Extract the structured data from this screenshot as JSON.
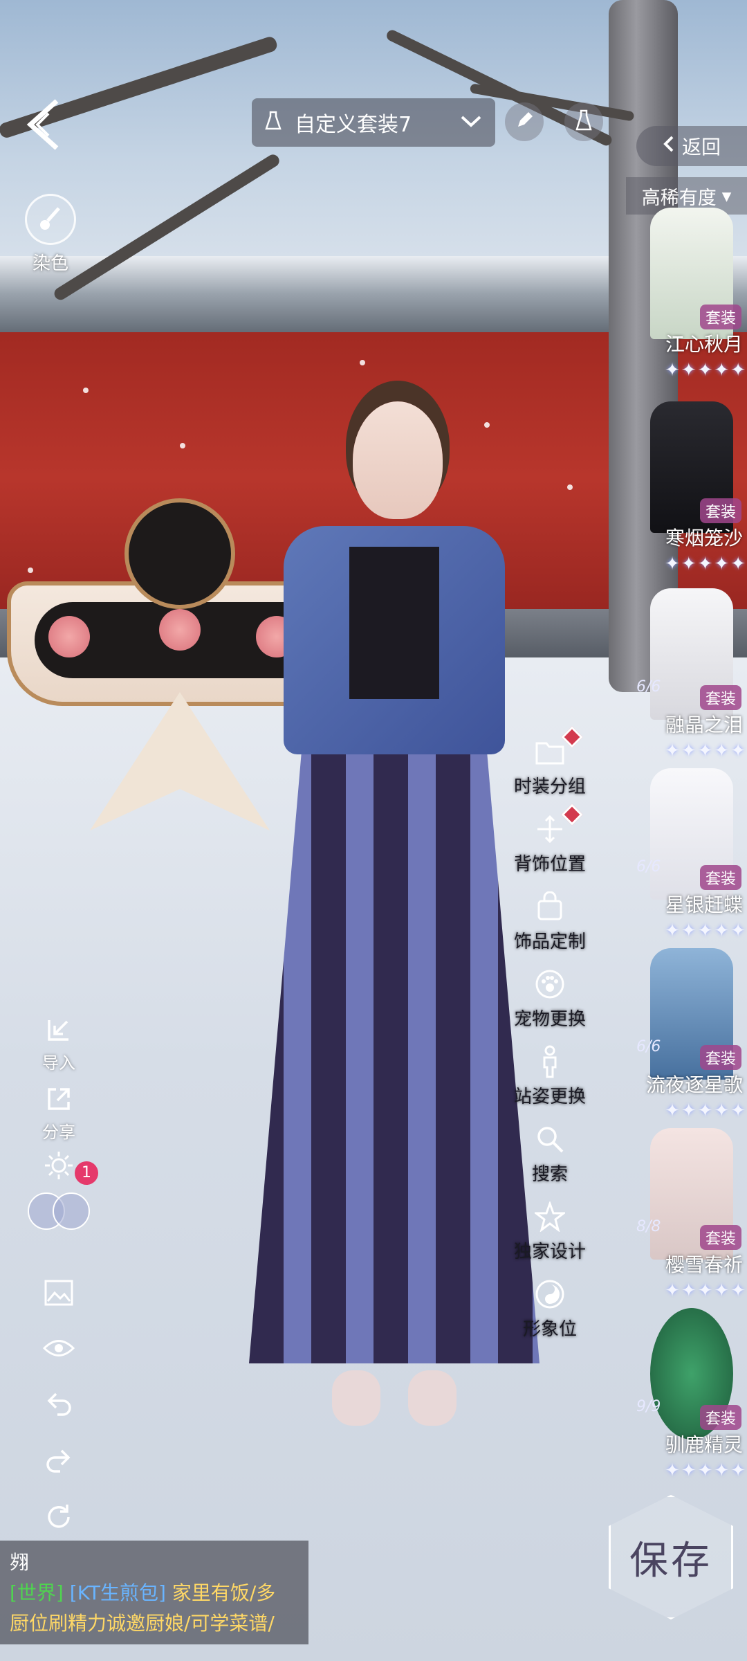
{
  "header": {
    "outfit_title": "自定义套装7",
    "return_label": "返回",
    "rarity_label": "高稀有度"
  },
  "left_panel": {
    "dye_label": "染色",
    "import_label": "导入",
    "share_label": "分享",
    "notification_count": "1"
  },
  "menu": {
    "items": [
      {
        "label": "时装分组"
      },
      {
        "label": "背饰位置"
      },
      {
        "label": "饰品定制"
      },
      {
        "label": "宠物更换"
      },
      {
        "label": "站姿更换"
      },
      {
        "label": "搜索"
      },
      {
        "label": "独家设计"
      },
      {
        "label": "形象位"
      }
    ]
  },
  "outfits": [
    {
      "name": "江心秋月",
      "tag": "套装",
      "count": "",
      "stars": "✦✦✦✦✦"
    },
    {
      "name": "寒烟笼沙",
      "tag": "套装",
      "count": "",
      "stars": "✦✦✦✦✦"
    },
    {
      "name": "融晶之泪",
      "tag": "套装",
      "count": "6/6",
      "stars": "✦✦✦✦✦"
    },
    {
      "name": "星银赶蝶",
      "tag": "套装",
      "count": "6/6",
      "stars": "✦✦✦✦✦"
    },
    {
      "name": "流夜逐星歌",
      "tag": "套装",
      "count": "6/6",
      "stars": "✦✦✦✦✦"
    },
    {
      "name": "樱雪春祈",
      "tag": "套装",
      "count": "8/8",
      "stars": "✦✦✦✦✦"
    },
    {
      "name": "驯鹿精灵",
      "tag": "套装",
      "count": "9/9",
      "stars": "✦✦✦✦✦"
    }
  ],
  "save_label": "保存",
  "chat": {
    "channel": "[世界]",
    "sender": "[KT生煎包]",
    "message_line1": "家里有饭/多",
    "message_line2": "厨位刷精力诚邀厨娘/可学菜谱/"
  },
  "colors": {
    "wall_red": "#b8362c",
    "channel_green": "#4fd44f",
    "sender_blue": "#69b4ff",
    "message_yellow": "#ffd866",
    "badge_pink": "#e5396b"
  }
}
